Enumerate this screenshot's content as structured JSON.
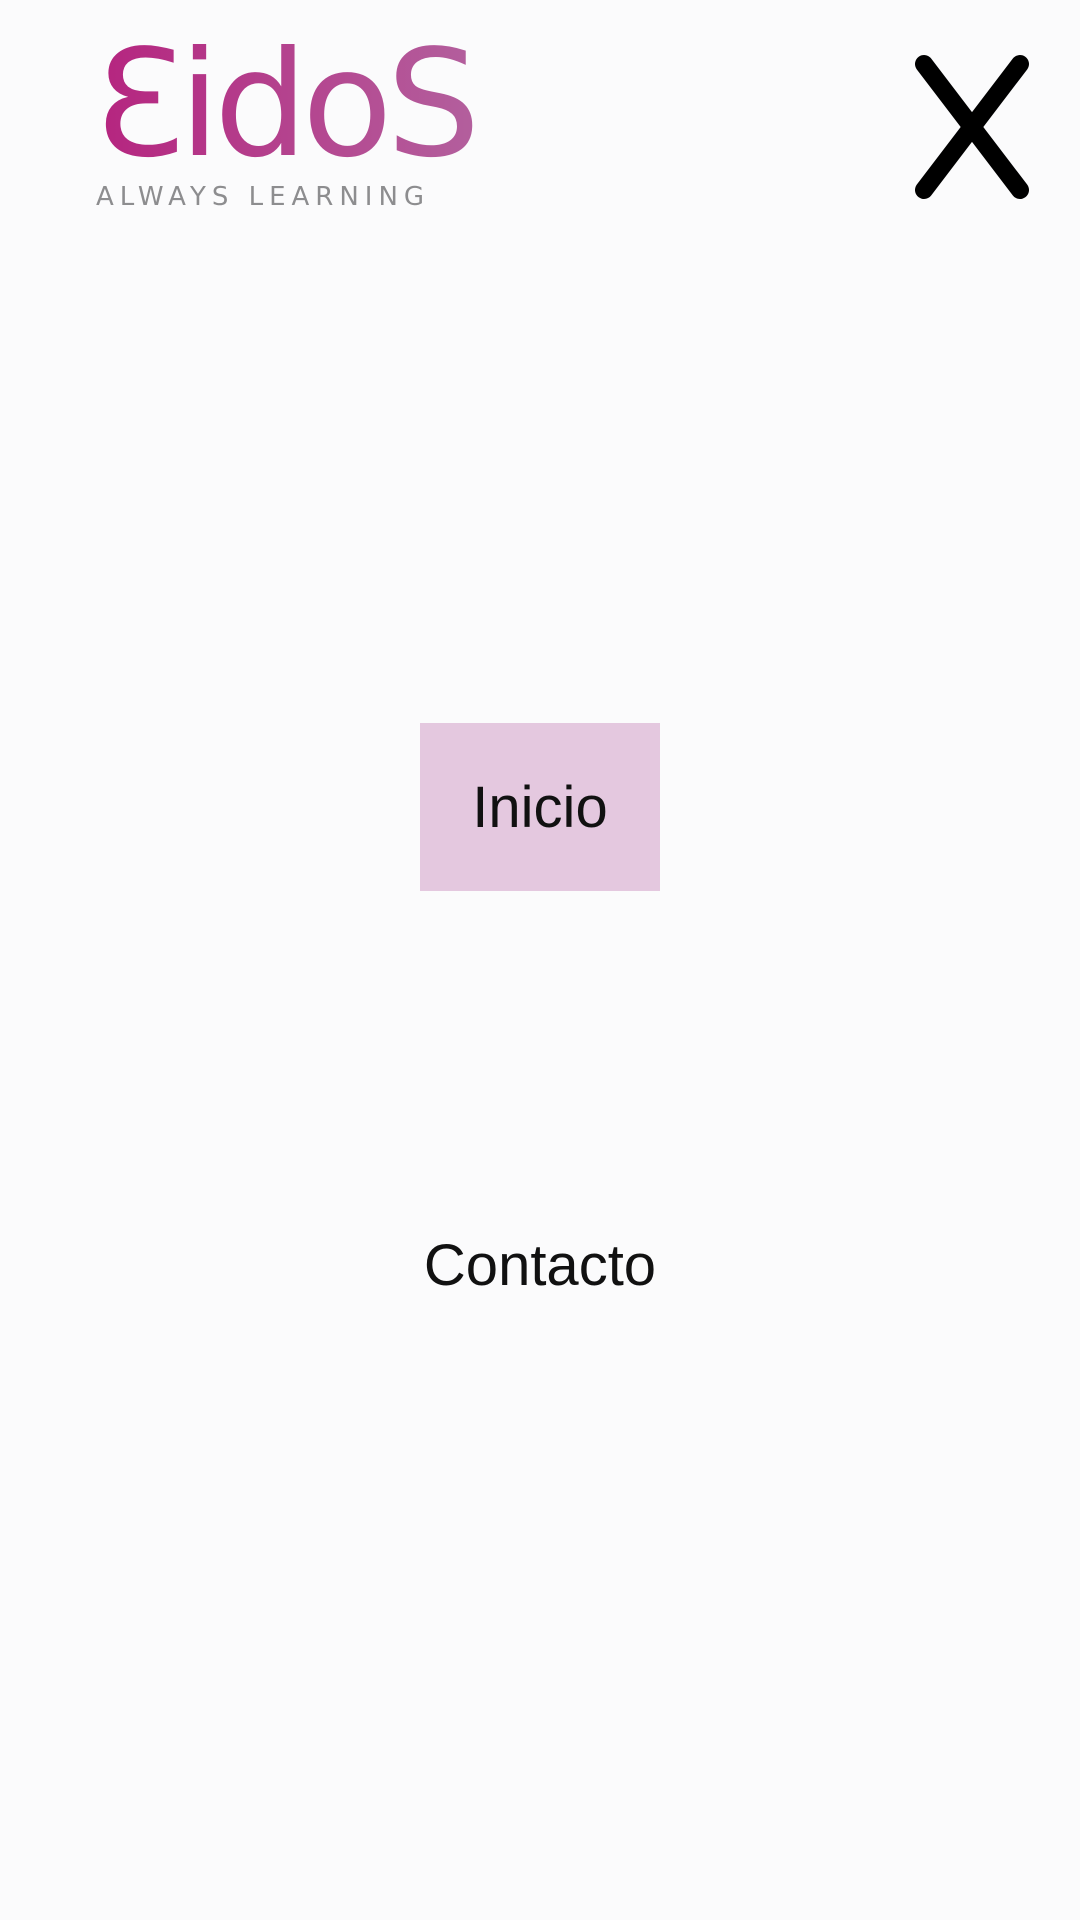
{
  "brand": {
    "logo_text": "ƐidoS",
    "tagline": "ALWAYS LEARNING",
    "gradient_start": "#b5247f",
    "gradient_end": "#b35f9d"
  },
  "header": {
    "close_icon": "close-icon"
  },
  "menu": {
    "items": [
      {
        "label": "Inicio",
        "active": true,
        "highlight_color": "#e4c8df"
      },
      {
        "label": "Contacto",
        "active": false
      }
    ]
  },
  "theme": {
    "background": "#fbfbfc",
    "text_color": "#111111",
    "tagline_color": "#8d8d8f"
  }
}
